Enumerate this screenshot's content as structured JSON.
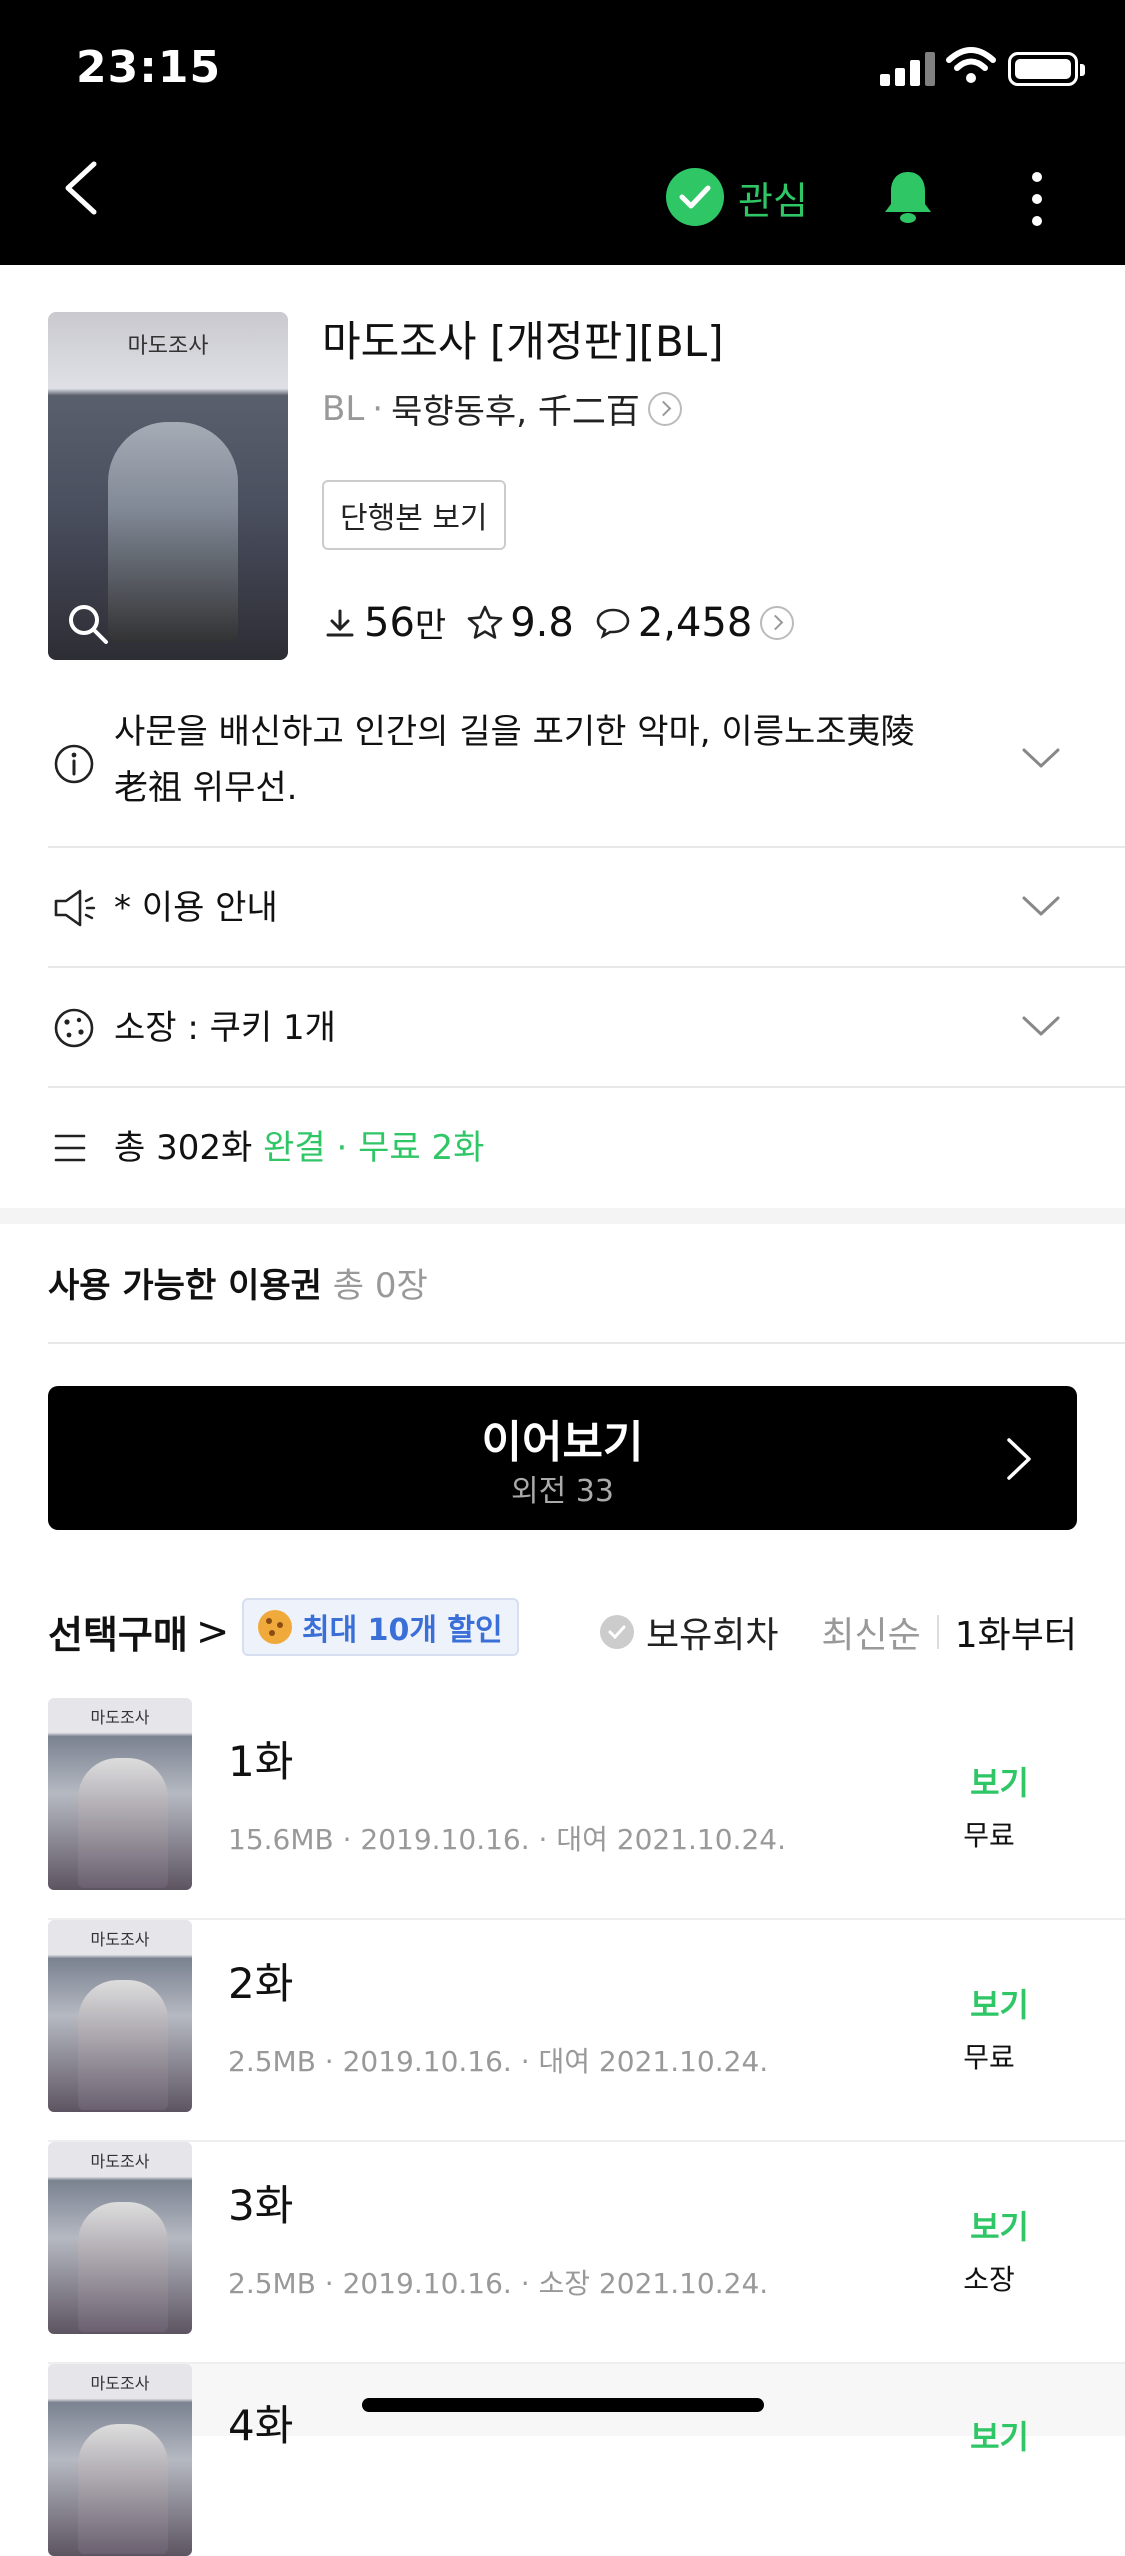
{
  "status_bar": {
    "time": "23:15"
  },
  "nav": {
    "interest_label": "관심"
  },
  "book": {
    "cover_title": "마도조사",
    "title": "마도조사 [개정판][BL]",
    "genre": "BL",
    "authors": "묵향동후, 千二百",
    "volume_button": "단행본 보기",
    "downloads": "56",
    "downloads_unit": "만",
    "rating": "9.8",
    "comments": "2,458"
  },
  "rows": {
    "synopsis": "사문을 배신하고 인간의 길을 포기한 악마, 이릉노조夷陵",
    "synopsis_line2": "老祖 위무선.",
    "notice": "* 이용 안내",
    "owned": "소장 : 쿠키 1개",
    "total": "총 302화",
    "status_complete": "완결",
    "free_count": "무료 2화"
  },
  "tickets": {
    "label": "사용 가능한 이용권",
    "count": "총 0장"
  },
  "continue_button": {
    "label": "이어보기",
    "sub": "외전 33"
  },
  "toolbar": {
    "select_buy": "선택구매",
    "discount": "최대 10개 할인",
    "owned_filter": "보유회차",
    "sort_latest": "최신순",
    "sort_first": "1화부터"
  },
  "episodes": [
    {
      "name": "1화",
      "info": "15.6MB · 2019.10.16. · 대여 2021.10.24.",
      "action": "보기",
      "price": "무료"
    },
    {
      "name": "2화",
      "info": "2.5MB · 2019.10.16. · 대여 2021.10.24.",
      "action": "보기",
      "price": "무료"
    },
    {
      "name": "3화",
      "info": "2.5MB · 2019.10.16. · 소장 2021.10.24.",
      "action": "보기",
      "price": "소장"
    },
    {
      "name": "4화",
      "info": "",
      "action": "보기",
      "price": ""
    }
  ],
  "colors": {
    "accent_green": "#2fc666",
    "discount_blue": "#3b6fd8"
  }
}
